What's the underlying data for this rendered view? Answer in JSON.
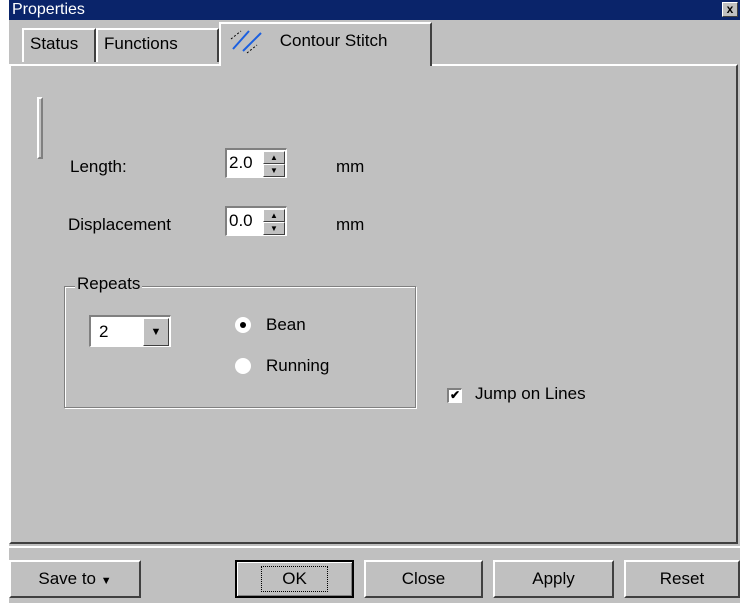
{
  "window": {
    "title": "Properties",
    "close_glyph": "x"
  },
  "tabs": [
    {
      "label": "Status"
    },
    {
      "label": "Functions"
    },
    {
      "label": "Contour Stitch",
      "icon": "contour-stitch-icon",
      "active": true
    }
  ],
  "length": {
    "label": "Length:",
    "value": "2.0",
    "unit": "mm"
  },
  "displacement": {
    "label": "Displacement",
    "value": "0.0",
    "unit": "mm"
  },
  "repeats": {
    "group_title": "Repeats",
    "count_value": "2",
    "options": [
      {
        "label": "Bean",
        "selected": true
      },
      {
        "label": "Running",
        "selected": false
      }
    ]
  },
  "jump_on_lines": {
    "label": "Jump on Lines",
    "checked": true
  },
  "buttons": {
    "save_to": "Save to",
    "ok": "OK",
    "close": "Close",
    "apply": "Apply",
    "reset": "Reset"
  },
  "colors": {
    "titlebar": "#0a246a",
    "face": "#c0c0c0",
    "icon_accent": "#1a5fe0"
  }
}
